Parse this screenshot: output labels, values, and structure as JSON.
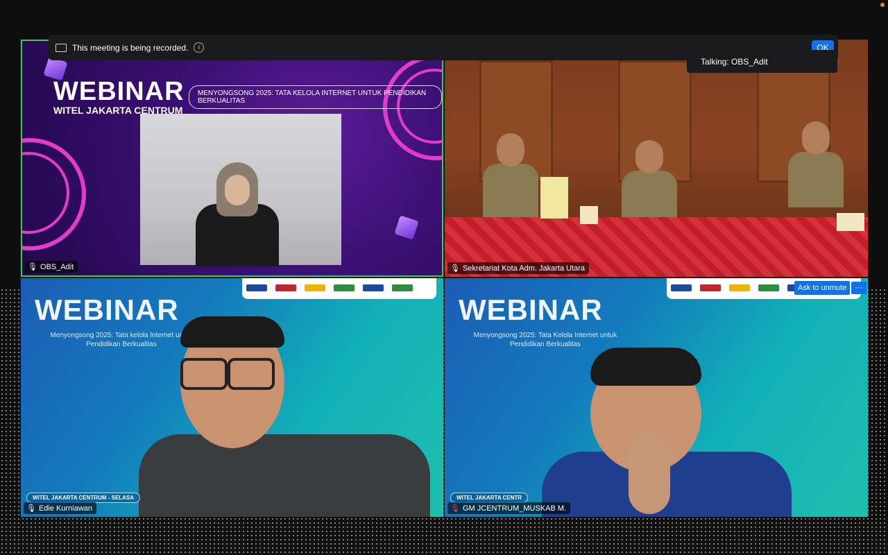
{
  "recording": {
    "message": "This meeting is being recorded.",
    "ok_label": "OK"
  },
  "talking": "Talking: OBS_Adit",
  "tiles": [
    {
      "name": "OBS_Adit",
      "webinar_title": "WEBINAR",
      "webinar_subtitle": "WITEL JAKARTA CENTRUM",
      "topic": "MENYONGSONG 2025: TATA KELOLA INTERNET UNTUK PENDIDIKAN BERKUALITAS",
      "active_speaker_color": "#3ecf4a"
    },
    {
      "name": "Sekretariat Kota Adm. Jakarta Utara"
    },
    {
      "name": "Edie Kurniawan",
      "webinar_title": "WEBINAR",
      "subtitle": "Menyongsong 2025: Tata kelola Internet untuk Pendidikan Berkualitas",
      "strip": "WITEL JAKARTA CENTRUM - SELASA"
    },
    {
      "name": "GM JCENTRUM_MUSKAB M.",
      "webinar_title": "WEBINAR",
      "subtitle": "Menyongsong 2025: Tata Kelola Internet untuk Pendidikan Berkualitas",
      "strip": "WITEL JAKARTA CENTR",
      "mic_muted_color": "#e5484d"
    }
  ],
  "controls": {
    "ask_unmute": "Ask to unmute",
    "more": "···"
  },
  "colors": {
    "zoom_blue": "#0e72ed",
    "background": "#0f0f10"
  }
}
